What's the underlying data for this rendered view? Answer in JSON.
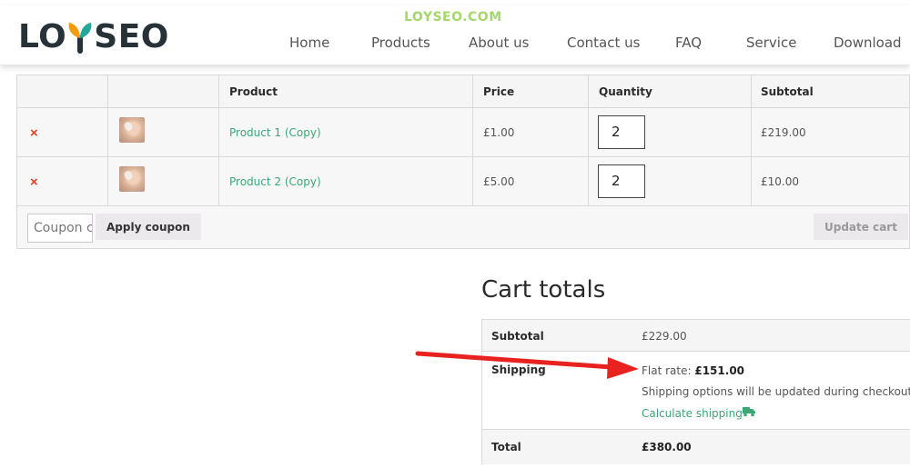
{
  "site": {
    "logo_text_left": "LO",
    "logo_text_right": "SEO",
    "watermark": "LOYSEO.COM"
  },
  "nav": {
    "items": [
      "Home",
      "Products",
      "About us",
      "Contact us",
      "FAQ",
      "Service",
      "Download"
    ]
  },
  "cart": {
    "headers": {
      "remove": "",
      "thumbnail": "",
      "product": "Product",
      "price": "Price",
      "quantity": "Quantity",
      "subtotal": "Subtotal"
    },
    "rows": [
      {
        "remove": "×",
        "name": "Product 1 (Copy)",
        "price": "£1.00",
        "quantity": "2",
        "subtotal": "£219.00"
      },
      {
        "remove": "×",
        "name": "Product 2 (Copy)",
        "price": "£5.00",
        "quantity": "2",
        "subtotal": "£10.00"
      }
    ],
    "coupon_placeholder": "Coupon code",
    "apply_coupon_label": "Apply coupon",
    "update_cart_label": "Update cart"
  },
  "totals": {
    "title": "Cart totals",
    "subtotal_label": "Subtotal",
    "subtotal_value": "£229.00",
    "shipping_label": "Shipping",
    "shipping_method": "Flat rate:",
    "shipping_amount": "£151.00",
    "shipping_note": "Shipping options will be updated during checkout.",
    "calculate_shipping": "Calculate shipping",
    "total_label": "Total",
    "total_value": "£380.00"
  },
  "colors": {
    "accent_green": "#3ba776",
    "remove_red": "#e2401c",
    "annotation_red": "#e8231f",
    "logo_dark": "#263238",
    "logo_orange": "#f39c12",
    "logo_teal": "#26a69a"
  }
}
